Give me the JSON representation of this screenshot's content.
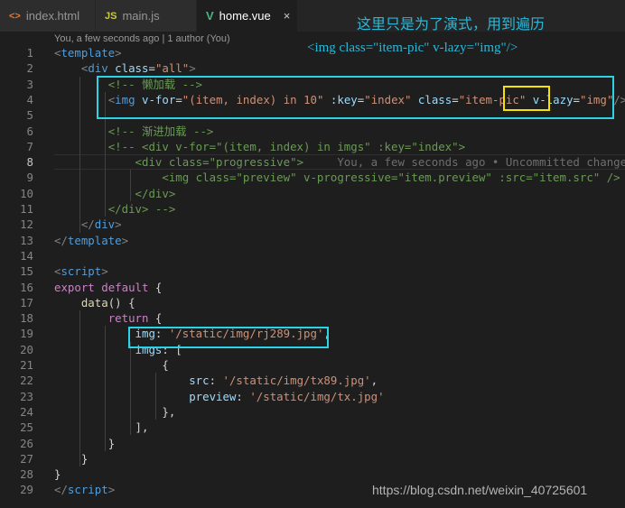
{
  "tabs": [
    {
      "icon": "<>",
      "label": "index.html",
      "icon_color": "#e37933"
    },
    {
      "icon": "JS",
      "label": "main.js",
      "icon_color": "#cbcb41"
    },
    {
      "icon": "V",
      "label": "home.vue",
      "icon_color": "#41b883",
      "close": "×"
    }
  ],
  "blame_header": "You, a few seconds ago | 1 author (You)",
  "annotation": {
    "line1": "这里只是为了演式，用到遍历",
    "line2": "<img class=\"item-pic\" v-lazy=\"img\"/>"
  },
  "editor": {
    "current_line": 8,
    "lines": [
      [
        {
          "t": "<",
          "c": "p"
        },
        {
          "t": "template",
          "c": "t"
        },
        {
          "t": ">",
          "c": "p"
        }
      ],
      [
        {
          "t": "    "
        },
        {
          "t": "<",
          "c": "p"
        },
        {
          "t": "div",
          "c": "t"
        },
        {
          "t": " "
        },
        {
          "t": "class",
          "c": "a"
        },
        {
          "t": "=",
          "c": "d"
        },
        {
          "t": "\"all\"",
          "c": "s"
        },
        {
          "t": ">",
          "c": "p"
        }
      ],
      [
        {
          "t": "        "
        },
        {
          "t": "<!-- 懒加载 -->",
          "c": "c"
        }
      ],
      [
        {
          "t": "        "
        },
        {
          "t": "<",
          "c": "p"
        },
        {
          "t": "img",
          "c": "t"
        },
        {
          "t": " "
        },
        {
          "t": "v-for",
          "c": "a"
        },
        {
          "t": "=",
          "c": "d"
        },
        {
          "t": "\"(item, index) in 10\"",
          "c": "s"
        },
        {
          "t": " "
        },
        {
          "t": ":key",
          "c": "a"
        },
        {
          "t": "=",
          "c": "d"
        },
        {
          "t": "\"index\"",
          "c": "s"
        },
        {
          "t": " "
        },
        {
          "t": "class",
          "c": "a"
        },
        {
          "t": "=",
          "c": "d"
        },
        {
          "t": "\"item-pic\"",
          "c": "s"
        },
        {
          "t": " "
        },
        {
          "t": "v-lazy",
          "c": "a"
        },
        {
          "t": "=",
          "c": "d"
        },
        {
          "t": "\"img\"",
          "c": "s"
        },
        {
          "t": "/>",
          "c": "p"
        }
      ],
      [],
      [
        {
          "t": "        "
        },
        {
          "t": "<!-- 渐进加载 -->",
          "c": "c"
        }
      ],
      [
        {
          "t": "        "
        },
        {
          "t": "<!-- <div v-for=\"(item, index) in imgs\" :key=\"index\">",
          "c": "c"
        }
      ],
      [
        {
          "t": "            "
        },
        {
          "t": "<div class=\"progressive\">",
          "c": "c"
        },
        {
          "t": "     You, a few seconds ago • Uncommitted changes",
          "c": "g"
        }
      ],
      [
        {
          "t": "                "
        },
        {
          "t": "<img class=\"preview\" v-progressive=\"item.preview\" :src=\"item.src\" />",
          "c": "c"
        }
      ],
      [
        {
          "t": "            "
        },
        {
          "t": "</div>",
          "c": "c"
        }
      ],
      [
        {
          "t": "        "
        },
        {
          "t": "</div> -->",
          "c": "c"
        }
      ],
      [
        {
          "t": "    "
        },
        {
          "t": "</",
          "c": "p"
        },
        {
          "t": "div",
          "c": "t"
        },
        {
          "t": ">",
          "c": "p"
        }
      ],
      [
        {
          "t": "</",
          "c": "p"
        },
        {
          "t": "template",
          "c": "t"
        },
        {
          "t": ">",
          "c": "p"
        }
      ],
      [],
      [
        {
          "t": "<",
          "c": "p"
        },
        {
          "t": "script",
          "c": "t"
        },
        {
          "t": ">",
          "c": "p"
        }
      ],
      [
        {
          "t": "export",
          "c": "k"
        },
        {
          "t": " "
        },
        {
          "t": "default",
          "c": "k"
        },
        {
          "t": " {",
          "c": "b"
        }
      ],
      [
        {
          "t": "    "
        },
        {
          "t": "data",
          "c": "f"
        },
        {
          "t": "() {",
          "c": "b"
        }
      ],
      [
        {
          "t": "        "
        },
        {
          "t": "return",
          "c": "k"
        },
        {
          "t": " {",
          "c": "b"
        }
      ],
      [
        {
          "t": "            "
        },
        {
          "t": "img",
          "c": "a"
        },
        {
          "t": ": ",
          "c": "b"
        },
        {
          "t": "'/static/img/rj289.jpg'",
          "c": "s"
        },
        {
          "t": ",",
          "c": "b"
        }
      ],
      [
        {
          "t": "            "
        },
        {
          "t": "imgs",
          "c": "a"
        },
        {
          "t": ": [",
          "c": "b"
        }
      ],
      [
        {
          "t": "                "
        },
        {
          "t": "{",
          "c": "b"
        }
      ],
      [
        {
          "t": "                    "
        },
        {
          "t": "src",
          "c": "a"
        },
        {
          "t": ": ",
          "c": "b"
        },
        {
          "t": "'/static/img/tx89.jpg'",
          "c": "s"
        },
        {
          "t": ",",
          "c": "b"
        }
      ],
      [
        {
          "t": "                    "
        },
        {
          "t": "preview",
          "c": "a"
        },
        {
          "t": ": ",
          "c": "b"
        },
        {
          "t": "'/static/img/tx.jpg'",
          "c": "s"
        }
      ],
      [
        {
          "t": "                "
        },
        {
          "t": "},",
          "c": "b"
        }
      ],
      [
        {
          "t": "            "
        },
        {
          "t": "],",
          "c": "b"
        }
      ],
      [
        {
          "t": "        "
        },
        {
          "t": "}",
          "c": "b"
        }
      ],
      [
        {
          "t": "    "
        },
        {
          "t": "}",
          "c": "b"
        }
      ],
      [
        {
          "t": "}",
          "c": "b"
        }
      ],
      [
        {
          "t": "</",
          "c": "p"
        },
        {
          "t": "script",
          "c": "t"
        },
        {
          "t": ">",
          "c": "p"
        }
      ]
    ]
  },
  "highlight_colors": {
    "cyan_box": "#2ad4e6",
    "yellow_box": "#f5e400"
  },
  "watermark": "https://blog.csdn.net/weixin_40725601"
}
